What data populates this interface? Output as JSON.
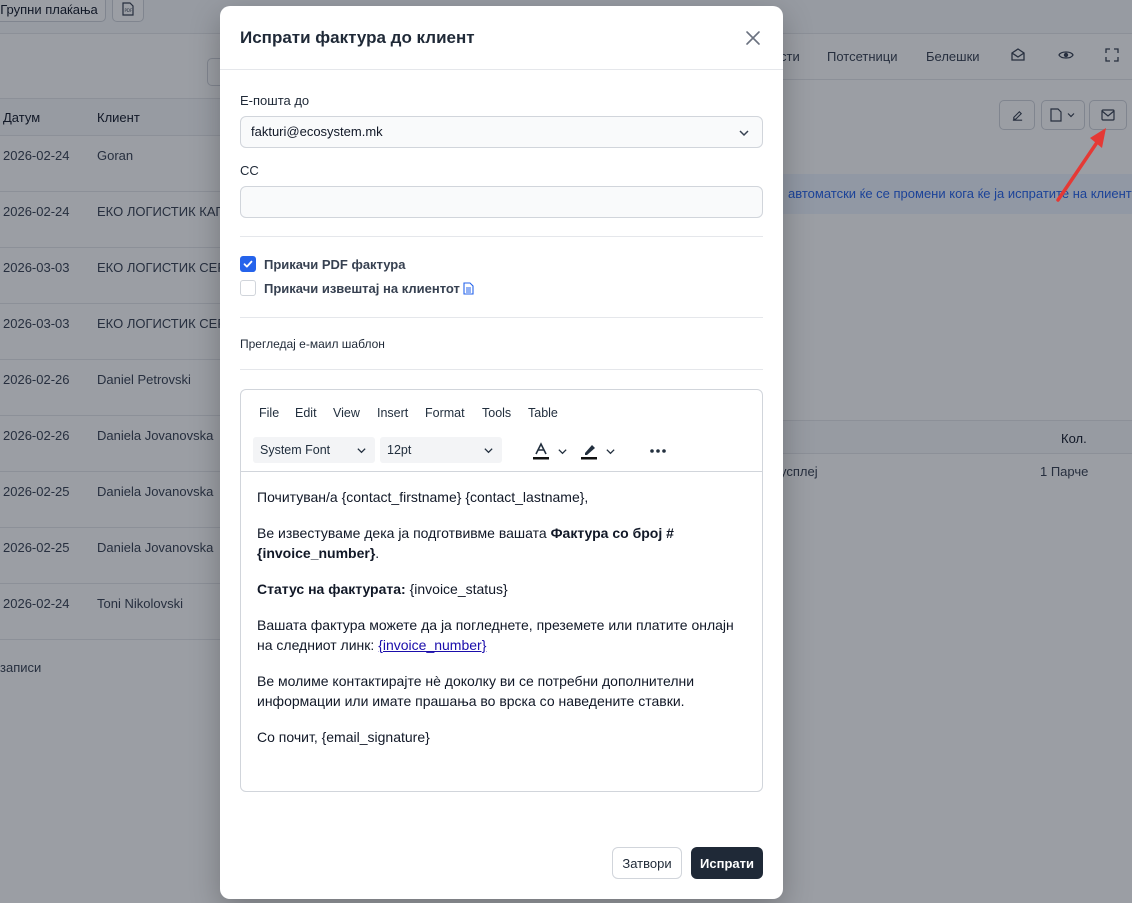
{
  "background": {
    "toolbar": {
      "bulk_payments": "Групни плаќања"
    },
    "table": {
      "headers": {
        "date": "Датум",
        "client": "Клиент"
      },
      "rows": [
        {
          "date": "2026-02-24",
          "client": "Goran"
        },
        {
          "date": "2026-02-24",
          "client": "ЕКО ЛОГИСТИК КАП"
        },
        {
          "date": "2026-03-03",
          "client": "ЕКО ЛОГИСТИК СЕР"
        },
        {
          "date": "2026-03-03",
          "client": "ЕКО ЛОГИСТИК СЕР"
        },
        {
          "date": "2026-02-26",
          "client": "Daniel Petrovski"
        },
        {
          "date": "2026-02-26",
          "client": "Daniela Jovanovska"
        },
        {
          "date": "2026-02-25",
          "client": "Daniela Jovanovska"
        },
        {
          "date": "2026-02-25",
          "client": "Daniela Jovanovska"
        },
        {
          "date": "2026-02-24",
          "client": "Toni Nikolovski"
        }
      ],
      "footer": "записи"
    },
    "tabs": {
      "t1": "сти",
      "reminders": "Потсетници",
      "notes": "Белешки"
    },
    "notice": "автоматски ќе се промени кога ќе ја испратите на клиент",
    "items": {
      "qty_header": "Кол.",
      "row_desc": "усплеј",
      "row_qty": "1 Парче"
    }
  },
  "modal": {
    "title": "Испрати фактура до клиент",
    "email_to_label": "Е-пошта до",
    "email_to_value": "fakturi@ecosystem.mk",
    "cc_label": "CC",
    "cc_value": "",
    "attach_pdf_label": "Прикачи PDF фактура",
    "attach_pdf_checked": true,
    "attach_report_label": "Прикачи извештај на клиентот",
    "attach_report_checked": false,
    "preview_label": "Прегледај е-маил шаблон",
    "editor": {
      "menu": [
        "File",
        "Edit",
        "View",
        "Insert",
        "Format",
        "Tools",
        "Table"
      ],
      "font_family": "System Font",
      "font_size": "12pt",
      "body": {
        "greeting": "Почитуван/а {contact_firstname} {contact_lastname},",
        "p1_pre": "Ве известуваме дека ја подготвивме вашата ",
        "p1_bold": "Фактура со број # {invoice_number}",
        "p1_post": ".",
        "status_label": "Статус на фактурата:",
        "status_value": " {invoice_status}",
        "p3_pre": "Вашата фактура можете да ја погледнете, преземете или платите онлајн на следниот линк: ",
        "p3_link": "{invoice_number}",
        "p4": "Ве молиме контактирајте нè доколку ви се потребни дополнителни информации или имате прашања во врска со наведените ставки.",
        "closing": "Со почит, {email_signature}"
      }
    },
    "buttons": {
      "close": "Затвори",
      "send": "Испрати"
    }
  },
  "colors": {
    "primary": "#2563eb",
    "dark": "#1f2937",
    "arrow": "#e53935"
  }
}
